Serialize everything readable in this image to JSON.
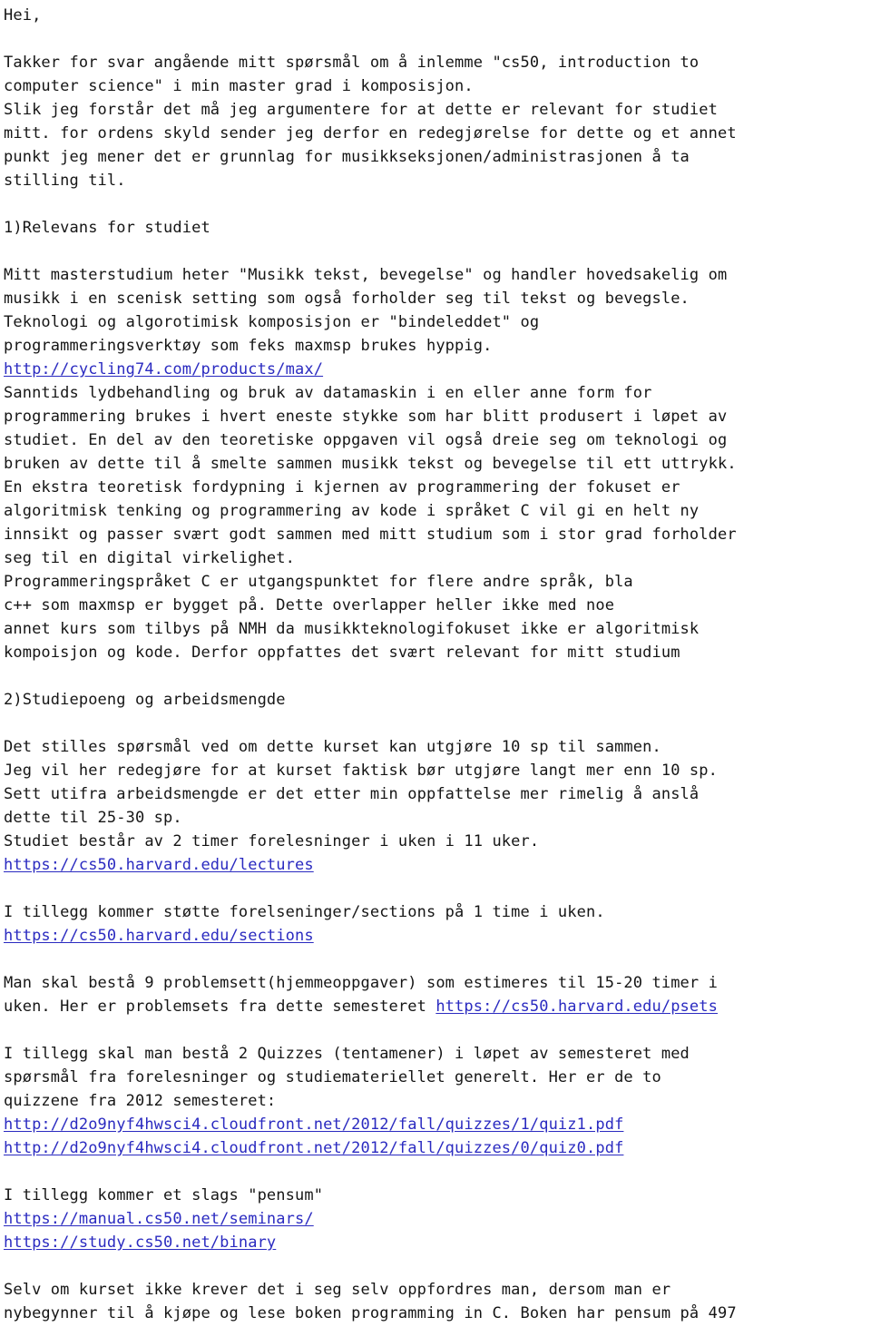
{
  "document": {
    "type": "plain-text-email-body",
    "language": "no",
    "text_color": "#151515",
    "link_color": "#2a2ac0",
    "background_color": "#ffffff",
    "lines": [
      {
        "id": "l1",
        "segments": [
          {
            "kind": "text",
            "value": "Hei,"
          }
        ]
      },
      {
        "id": "l2",
        "segments": [
          {
            "kind": "text",
            "value": ""
          }
        ]
      },
      {
        "id": "l3",
        "segments": [
          {
            "kind": "text",
            "value": "Takker for svar angående mitt spørsmål om å inlemme \"cs50, introduction to"
          }
        ]
      },
      {
        "id": "l4",
        "segments": [
          {
            "kind": "text",
            "value": "computer science\" i min master grad i komposisjon."
          }
        ]
      },
      {
        "id": "l5",
        "segments": [
          {
            "kind": "text",
            "value": "Slik jeg forstår det må jeg argumentere for at dette er relevant for studiet"
          }
        ]
      },
      {
        "id": "l6",
        "segments": [
          {
            "kind": "text",
            "value": "mitt. for ordens skyld sender jeg derfor en redegjørelse for dette og et annet"
          }
        ]
      },
      {
        "id": "l7",
        "segments": [
          {
            "kind": "text",
            "value": "punkt jeg mener det er grunnlag for musikkseksjonen/administrasjonen å ta"
          }
        ]
      },
      {
        "id": "l8",
        "segments": [
          {
            "kind": "text",
            "value": "stilling til."
          }
        ]
      },
      {
        "id": "l9",
        "segments": [
          {
            "kind": "text",
            "value": ""
          }
        ]
      },
      {
        "id": "l10",
        "segments": [
          {
            "kind": "text",
            "value": "1)Relevans for studiet"
          }
        ]
      },
      {
        "id": "l11",
        "segments": [
          {
            "kind": "text",
            "value": ""
          }
        ]
      },
      {
        "id": "l12",
        "segments": [
          {
            "kind": "text",
            "value": "Mitt masterstudium heter \"Musikk tekst, bevegelse\" og handler hovedsakelig om"
          }
        ]
      },
      {
        "id": "l13",
        "segments": [
          {
            "kind": "text",
            "value": "musikk i en scenisk setting som også forholder seg til tekst og bevegsle."
          }
        ]
      },
      {
        "id": "l14",
        "segments": [
          {
            "kind": "text",
            "value": "Teknologi og algorotimisk komposisjon er \"bindeleddet\" og"
          }
        ]
      },
      {
        "id": "l15",
        "segments": [
          {
            "kind": "text",
            "value": "programmeringsverktøy som feks maxmsp brukes hyppig."
          }
        ]
      },
      {
        "id": "l16",
        "segments": [
          {
            "kind": "link",
            "value": "http://cycling74.com/products/max/"
          }
        ]
      },
      {
        "id": "l17",
        "segments": [
          {
            "kind": "text",
            "value": "Sanntids lydbehandling og bruk av datamaskin i en eller anne form for"
          }
        ]
      },
      {
        "id": "l18",
        "segments": [
          {
            "kind": "text",
            "value": "programmering brukes i hvert eneste stykke som har blitt produsert i løpet av"
          }
        ]
      },
      {
        "id": "l19",
        "segments": [
          {
            "kind": "text",
            "value": "studiet. En del av den teoretiske oppgaven vil også dreie seg om teknologi og"
          }
        ]
      },
      {
        "id": "l20",
        "segments": [
          {
            "kind": "text",
            "value": "bruken av dette til å smelte sammen musikk tekst og bevegelse til ett uttrykk."
          }
        ]
      },
      {
        "id": "l21",
        "segments": [
          {
            "kind": "text",
            "value": "En ekstra teoretisk fordypning i kjernen av programmering der fokuset er"
          }
        ]
      },
      {
        "id": "l22",
        "segments": [
          {
            "kind": "text",
            "value": "algoritmisk tenking og programmering av kode i språket C vil gi en helt ny"
          }
        ]
      },
      {
        "id": "l23",
        "segments": [
          {
            "kind": "text",
            "value": "innsikt og passer svært godt sammen med mitt studium som i stor grad forholder"
          }
        ]
      },
      {
        "id": "l24",
        "segments": [
          {
            "kind": "text",
            "value": "seg til en digital virkelighet."
          }
        ]
      },
      {
        "id": "l25",
        "segments": [
          {
            "kind": "text",
            "value": "Programmeringspråket C er utgangspunktet for flere andre språk, bla"
          }
        ]
      },
      {
        "id": "l26",
        "segments": [
          {
            "kind": "text",
            "value": "c++ som maxmsp er bygget på. Dette overlapper heller ikke med noe"
          }
        ]
      },
      {
        "id": "l27",
        "segments": [
          {
            "kind": "text",
            "value": "annet kurs som tilbys på NMH da musikkteknologifokuset ikke er algoritmisk"
          }
        ]
      },
      {
        "id": "l28",
        "segments": [
          {
            "kind": "text",
            "value": "kompoisjon og kode. Derfor oppfattes det svært relevant for mitt studium"
          }
        ]
      },
      {
        "id": "l29",
        "segments": [
          {
            "kind": "text",
            "value": ""
          }
        ]
      },
      {
        "id": "l30",
        "segments": [
          {
            "kind": "text",
            "value": "2)Studiepoeng og arbeidsmengde"
          }
        ]
      },
      {
        "id": "l31",
        "segments": [
          {
            "kind": "text",
            "value": ""
          }
        ]
      },
      {
        "id": "l32",
        "segments": [
          {
            "kind": "text",
            "value": "Det stilles spørsmål ved om dette kurset kan utgjøre 10 sp til sammen."
          }
        ]
      },
      {
        "id": "l33",
        "segments": [
          {
            "kind": "text",
            "value": "Jeg vil her redegjøre for at kurset faktisk bør utgjøre langt mer enn 10 sp."
          }
        ]
      },
      {
        "id": "l34",
        "segments": [
          {
            "kind": "text",
            "value": "Sett utifra arbeidsmengde er det etter min oppfattelse mer rimelig å anslå"
          }
        ]
      },
      {
        "id": "l35",
        "segments": [
          {
            "kind": "text",
            "value": "dette til 25-30 sp."
          }
        ]
      },
      {
        "id": "l36",
        "segments": [
          {
            "kind": "text",
            "value": "Studiet består av 2 timer forelesninger i uken i 11 uker."
          }
        ]
      },
      {
        "id": "l37",
        "segments": [
          {
            "kind": "link",
            "value": "https://cs50.harvard.edu/lectures"
          }
        ]
      },
      {
        "id": "l38",
        "segments": [
          {
            "kind": "text",
            "value": ""
          }
        ]
      },
      {
        "id": "l39",
        "segments": [
          {
            "kind": "text",
            "value": "I tillegg kommer støtte forelseninger/sections på 1 time i uken."
          }
        ]
      },
      {
        "id": "l40",
        "segments": [
          {
            "kind": "link",
            "value": "https://cs50.harvard.edu/sections"
          }
        ]
      },
      {
        "id": "l41",
        "segments": [
          {
            "kind": "text",
            "value": ""
          }
        ]
      },
      {
        "id": "l42",
        "segments": [
          {
            "kind": "text",
            "value": "Man skal bestå 9 problemsett(hjemmeoppgaver) som estimeres til 15-20 timer i"
          }
        ]
      },
      {
        "id": "l43",
        "segments": [
          {
            "kind": "text",
            "value": "uken. Her er problemsets fra dette semesteret "
          },
          {
            "kind": "link",
            "value": "https://cs50.harvard.edu/psets"
          }
        ]
      },
      {
        "id": "l44",
        "segments": [
          {
            "kind": "text",
            "value": ""
          }
        ]
      },
      {
        "id": "l45",
        "segments": [
          {
            "kind": "text",
            "value": "I tillegg skal man bestå 2 Quizzes (tentamener) i løpet av semesteret med"
          }
        ]
      },
      {
        "id": "l46",
        "segments": [
          {
            "kind": "text",
            "value": "spørsmål fra forelesninger og studiemateriellet generelt. Her er de to"
          }
        ]
      },
      {
        "id": "l47",
        "segments": [
          {
            "kind": "text",
            "value": "quizzene fra 2012 semesteret:"
          }
        ]
      },
      {
        "id": "l48",
        "segments": [
          {
            "kind": "link",
            "value": "http://d2o9nyf4hwsci4.cloudfront.net/2012/fall/quizzes/1/quiz1.pdf"
          }
        ]
      },
      {
        "id": "l49",
        "segments": [
          {
            "kind": "link",
            "value": "http://d2o9nyf4hwsci4.cloudfront.net/2012/fall/quizzes/0/quiz0.pdf"
          }
        ]
      },
      {
        "id": "l50",
        "segments": [
          {
            "kind": "text",
            "value": ""
          }
        ]
      },
      {
        "id": "l51",
        "segments": [
          {
            "kind": "text",
            "value": "I tillegg kommer et slags \"pensum\""
          }
        ]
      },
      {
        "id": "l52",
        "segments": [
          {
            "kind": "link",
            "value": "https://manual.cs50.net/seminars/"
          }
        ]
      },
      {
        "id": "l53",
        "segments": [
          {
            "kind": "link",
            "value": "https://study.cs50.net/binary"
          }
        ]
      },
      {
        "id": "l54",
        "segments": [
          {
            "kind": "text",
            "value": ""
          }
        ]
      },
      {
        "id": "l55",
        "segments": [
          {
            "kind": "text",
            "value": "Selv om kurset ikke krever det i seg selv oppfordres man, dersom man er"
          }
        ]
      },
      {
        "id": "l56",
        "segments": [
          {
            "kind": "text",
            "value": "nybegynner til å kjøpe og lese boken programming in C. Boken har pensum på 497"
          }
        ]
      }
    ]
  }
}
